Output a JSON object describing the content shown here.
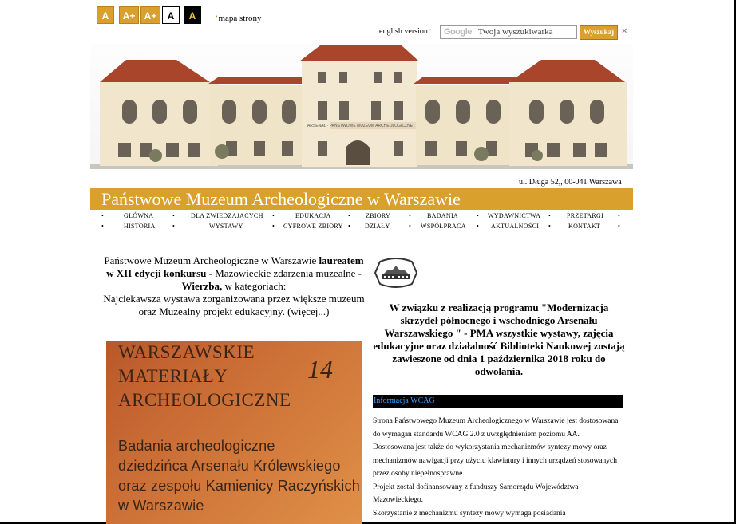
{
  "font_size_buttons": [
    "A",
    "A+",
    "A+",
    "A",
    "A"
  ],
  "sitemap_label": "mapa strony",
  "english_label": "english version",
  "search": {
    "google_label": "Google",
    "placeholder": "Twoja wyszukiwarka",
    "button": "Wyszukaj",
    "close": "×"
  },
  "hero_sign": "ARSENAŁ · PAŃSTWOWE MUZEUM ARCHEOLOGICZNE",
  "address": "ul. Długa 52,, 00-041 Warszawa",
  "site_title": "Państwowe Muzeum Archeologiczne w Warszawie",
  "nav_row1": [
    "GŁÓWNA",
    "DLA ZWIEDZAJĄCYCH",
    "EDUKACJA",
    "ZBIORY",
    "BADANIA",
    "WYDAWNICTWA",
    "PRZETARGI"
  ],
  "nav_row2": [
    "HISTORIA",
    "WYSTAWY",
    "CYFROWE ZBIORY",
    "DZIAŁY",
    "WSPÓŁPRACA",
    "AKTUALNOŚCI",
    "KONTAKT"
  ],
  "award": {
    "p1": "Państwowe Muzeum Archeologiczne w Warszawie ",
    "b1": "laureatem w XII edycji konkursu",
    "p2": " - Mazowieckie zdarzenia muzealne - ",
    "b2": "Wierzba,",
    "p3": " w kategoriach:",
    "p4": "Najciekawsza wystawa zorganizowana przez większe muzeum oraz Muzealny projekt edukacyjny. (więcej...)"
  },
  "cover": {
    "line1": "WARSZAWSKIE",
    "line2": "MATERIAŁY",
    "line3": "ARCHEOLOGICZNE",
    "number": "14",
    "sub1": "Badania archeologiczne",
    "sub2": "dziedzińca Arsenału Królewskiego",
    "sub3": "oraz zespołu Kamienicy Raczyńskich",
    "sub4": "w Warszawie"
  },
  "notice": "W związku z realizacją programu \"Modernizacja skrzydeł północnego i wschodniego Arsenału Warszawskiego \" - PMA wszystkie wystawy, zajęcia edukacyjne oraz działalność Biblioteki Naukowej zostają zawieszone od dnia 1 października 2018 roku do odwołania.",
  "wcag": {
    "title": "Informacja WCAG",
    "p1": "Strona Państwowego Muzeum Archeologicznego w Warszawie jest dostosowana do wymagań standardu WCAG 2.0 z uwzględnieniem poziomu AA.",
    "p2": "Dostosowana jest także do wykorzystania mechanizmów syntezy mowy oraz mechanizmów nawigacji przy użyciu klawiatury i innych urządzeń stosowanych przez osoby niepełnosprawne.",
    "p3": "Projekt został dofinansowany z funduszy Samorządu Województwa Mazowieckiego.",
    "p4": "Skorzystanie z mechanizmu syntezy mowy wymaga posiadania"
  },
  "colors": {
    "accent": "#d9a02d",
    "wcag_title_text": "#3aa0ff"
  }
}
